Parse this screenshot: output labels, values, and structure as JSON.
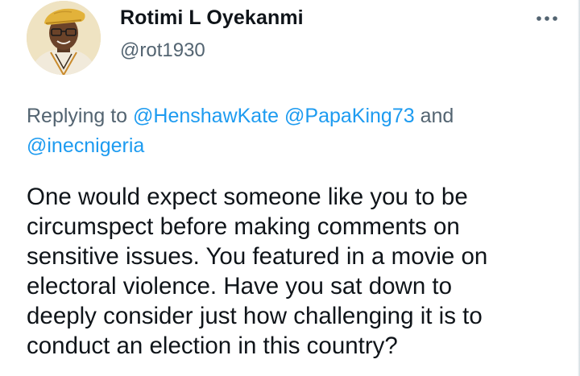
{
  "author": {
    "name": "Rotimi L Oyekanmi",
    "handle": "@rot1930"
  },
  "more_icon": "ellipsis-horizontal-icon",
  "reply": {
    "prefix": "Replying to ",
    "mentions": [
      "@HenshawKate",
      "@PapaKing73",
      "@inecnigeria"
    ],
    "separator": " ",
    "conjunction": " and "
  },
  "tweet": {
    "lines": [
      "One would expect someone like you to be",
      "circumspect before making comments on",
      "sensitive issues. You featured in a movie on",
      "electoral violence. Have you sat down to",
      "deeply consider just how challenging it is to",
      "conduct an election in this country?"
    ]
  },
  "colors": {
    "text": "#0f1419",
    "secondary": "#536471",
    "link": "#1d9bf0",
    "background": "#ffffff"
  }
}
